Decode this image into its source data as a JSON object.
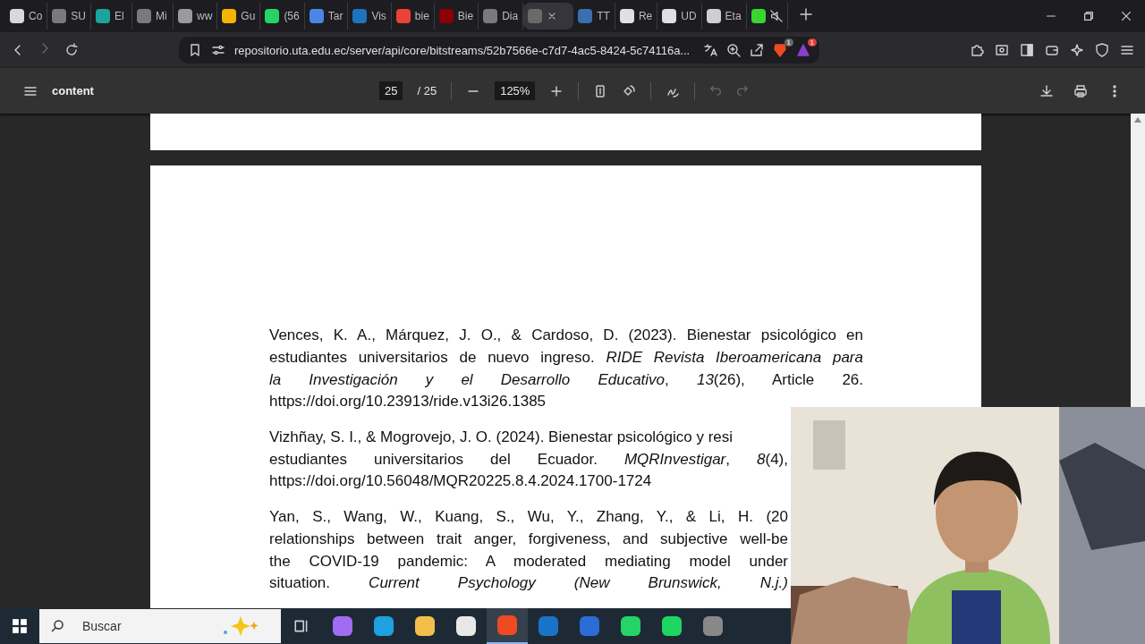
{
  "tabs": [
    {
      "label": "Co",
      "color": "#d9d9d9",
      "selected": false,
      "muted": false
    },
    {
      "label": "SU",
      "color": "#7a7a7a",
      "selected": false,
      "muted": false
    },
    {
      "label": "El",
      "color": "#1ba39c",
      "selected": false,
      "muted": false
    },
    {
      "label": "Mi",
      "color": "#7a7a7a",
      "selected": false,
      "muted": false
    },
    {
      "label": "ww",
      "color": "#9a9a9a",
      "selected": false,
      "muted": false
    },
    {
      "label": "Gu",
      "color": "#f4b400",
      "selected": false,
      "muted": false
    },
    {
      "label": "(56",
      "color": "#25d366",
      "selected": false,
      "muted": false
    },
    {
      "label": "Tar",
      "color": "#4a86e8",
      "selected": false,
      "muted": false
    },
    {
      "label": "Vis",
      "color": "#1e73be",
      "selected": false,
      "muted": false
    },
    {
      "label": "bie",
      "color": "#ea4335",
      "selected": false,
      "muted": false
    },
    {
      "label": "Bie",
      "color": "#8b0000",
      "selected": false,
      "muted": false
    },
    {
      "label": "Dia",
      "color": "#7a7a7a",
      "selected": false,
      "muted": false
    },
    {
      "color": "#6a6a6a",
      "selected": true,
      "muted": false
    },
    {
      "label": "TT",
      "color": "#3a6fb0",
      "selected": false,
      "muted": false
    },
    {
      "label": "Re",
      "color": "#e0e0e0",
      "selected": false,
      "muted": false
    },
    {
      "label": "UD",
      "color": "#e0e0e0",
      "selected": false,
      "muted": false
    },
    {
      "label": "Eta",
      "color": "#cfcfcf",
      "selected": false,
      "muted": false
    },
    {
      "color": "#39d62f",
      "selected": false,
      "muted": true
    }
  ],
  "address_bar": {
    "url": "repositorio.uta.edu.ec/server/api/core/bitstreams/52b7566e-c7d7-4ac5-8424-5c74116a...",
    "shield_badge": "1",
    "rewards_badge": "1"
  },
  "pdf_toolbar": {
    "title": "content",
    "page": "25",
    "page_total": "/ 25",
    "zoom": "125%",
    "undo_disabled": true,
    "redo_disabled": true
  },
  "references": [
    {
      "lines": [
        {
          "text": "Vences, K. A., Márquez, J. O., & Cardoso, D. (2023). Bienestar psicológico en",
          "justify": true
        },
        {
          "text": "estudiantes universitarios de nuevo ingreso. *RIDE Revista Iberoamericana para*",
          "justify": true
        },
        {
          "text": "*la Investigación y el Desarrollo Educativo*, *13*(26), Article 26.",
          "justify": true
        },
        {
          "text": "https://doi.org/10.23913/ride.v13i26.1385",
          "justify": false
        }
      ]
    },
    {
      "lines": [
        {
          "text": "Vizhñay, S. I., & Mogrovejo, J. O. (2024). Bienestar psicológico y resi",
          "justify": false
        },
        {
          "text": "estudiantes universitarios del Ecuador. *MQRInvestigar*, *8*(4),",
          "justify": true
        },
        {
          "text": "https://doi.org/10.56048/MQR20225.8.4.2024.1700-1724",
          "justify": false
        }
      ]
    },
    {
      "lines": [
        {
          "text": "Yan, S., Wang, W., Kuang, S., Wu, Y., Zhang, Y., & Li, H. (20",
          "justify": true
        },
        {
          "text": "relationships between trait anger, forgiveness, and subjective well-be",
          "justify": true
        },
        {
          "text": "the COVID-19 pandemic: A moderated mediating model under",
          "justify": true
        },
        {
          "text": "situation. *Current Psychology (New Brunswick, N.j.)*",
          "justify": true
        }
      ]
    }
  ],
  "taskbar": {
    "search_placeholder": "Buscar",
    "apps": [
      {
        "color": "#a06cf0",
        "selected": false
      },
      {
        "color": "#1fa0e0",
        "selected": false
      },
      {
        "color": "#f2c04a",
        "selected": false
      },
      {
        "color": "#e8e8e8",
        "selected": false
      },
      {
        "color": "#f04a23",
        "selected": true
      },
      {
        "color": "#1a73c8",
        "selected": false
      },
      {
        "color": "#2b6cd6",
        "selected": false
      },
      {
        "color": "#25d366",
        "selected": false
      },
      {
        "color": "#1ed760",
        "selected": false
      },
      {
        "color": "#888888",
        "selected": false
      }
    ]
  }
}
